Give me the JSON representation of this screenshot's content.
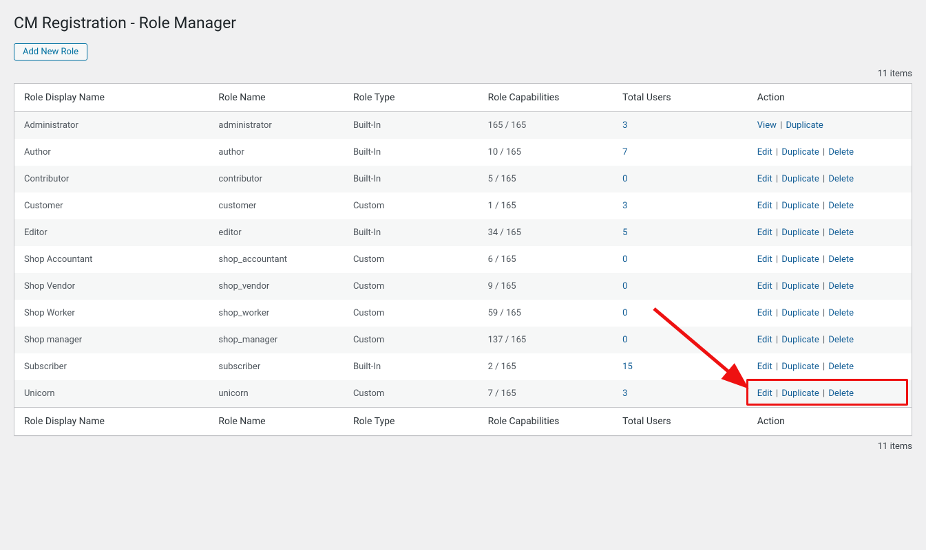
{
  "page": {
    "title": "CM Registration - Role Manager",
    "add_new_label": "Add New Role",
    "items_count_text": "11 items"
  },
  "table": {
    "headers": {
      "display_name": "Role Display Name",
      "role_name": "Role Name",
      "role_type": "Role Type",
      "capabilities": "Role Capabilities",
      "total_users": "Total Users",
      "action": "Action"
    }
  },
  "actions": {
    "view": "View",
    "edit": "Edit",
    "duplicate": "Duplicate",
    "delete": "Delete"
  },
  "rows": [
    {
      "display": "Administrator",
      "name": "administrator",
      "type": "Built-In",
      "caps": "165 / 165",
      "users": "3",
      "actions": [
        "view",
        "duplicate"
      ]
    },
    {
      "display": "Author",
      "name": "author",
      "type": "Built-In",
      "caps": "10 / 165",
      "users": "7",
      "actions": [
        "edit",
        "duplicate",
        "delete"
      ]
    },
    {
      "display": "Contributor",
      "name": "contributor",
      "type": "Built-In",
      "caps": "5 / 165",
      "users": "0",
      "actions": [
        "edit",
        "duplicate",
        "delete"
      ]
    },
    {
      "display": "Customer",
      "name": "customer",
      "type": "Custom",
      "caps": "1 / 165",
      "users": "3",
      "actions": [
        "edit",
        "duplicate",
        "delete"
      ]
    },
    {
      "display": "Editor",
      "name": "editor",
      "type": "Built-In",
      "caps": "34 / 165",
      "users": "5",
      "actions": [
        "edit",
        "duplicate",
        "delete"
      ]
    },
    {
      "display": "Shop Accountant",
      "name": "shop_accountant",
      "type": "Custom",
      "caps": "6 / 165",
      "users": "0",
      "actions": [
        "edit",
        "duplicate",
        "delete"
      ]
    },
    {
      "display": "Shop Vendor",
      "name": "shop_vendor",
      "type": "Custom",
      "caps": "9 / 165",
      "users": "0",
      "actions": [
        "edit",
        "duplicate",
        "delete"
      ]
    },
    {
      "display": "Shop Worker",
      "name": "shop_worker",
      "type": "Custom",
      "caps": "59 / 165",
      "users": "0",
      "actions": [
        "edit",
        "duplicate",
        "delete"
      ]
    },
    {
      "display": "Shop manager",
      "name": "shop_manager",
      "type": "Custom",
      "caps": "137 / 165",
      "users": "0",
      "actions": [
        "edit",
        "duplicate",
        "delete"
      ]
    },
    {
      "display": "Subscriber",
      "name": "subscriber",
      "type": "Built-In",
      "caps": "2 / 165",
      "users": "15",
      "actions": [
        "edit",
        "duplicate",
        "delete"
      ]
    },
    {
      "display": "Unicorn",
      "name": "unicorn",
      "type": "Custom",
      "caps": "7 / 165",
      "users": "3",
      "actions": [
        "edit",
        "duplicate",
        "delete"
      ]
    }
  ],
  "annotation": {
    "highlight_row_index": 10,
    "arrow_color": "#e11"
  }
}
